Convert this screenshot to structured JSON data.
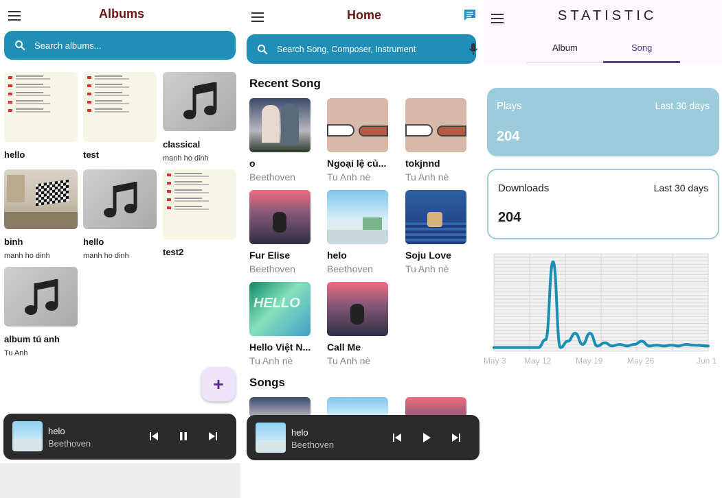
{
  "albums_screen": {
    "title": "Albums",
    "search_placeholder": "Search albums...",
    "albums": [
      {
        "name": "hello",
        "artist": ""
      },
      {
        "name": "test",
        "artist": ""
      },
      {
        "name": "classical",
        "artist": "manh ho dinh"
      },
      {
        "name": "binh",
        "artist": "manh ho dinh"
      },
      {
        "name": "hello",
        "artist": "manh ho dinh"
      },
      {
        "name": "test2",
        "artist": ""
      },
      {
        "name": "album tú anh",
        "artist": "Tu Anh"
      }
    ],
    "fab_label": "+",
    "player": {
      "title": "helo",
      "artist": "Beethoven",
      "state": "playing"
    }
  },
  "home_screen": {
    "title": "Home",
    "search_placeholder": "Search Song, Composer, Instrument",
    "recent_heading": "Recent Song",
    "recent": [
      {
        "title": "o",
        "artist": "Beethoven"
      },
      {
        "title": "Ngoại lệ củ...",
        "artist": "Tu Anh nè"
      },
      {
        "title": "tokjnnd",
        "artist": "Tu Anh nè"
      },
      {
        "title": "Fur Elise",
        "artist": "Beethoven"
      },
      {
        "title": "helo",
        "artist": "Beethoven"
      },
      {
        "title": "Soju Love",
        "artist": "Tu Anh nè"
      },
      {
        "title": "Hello Việt N...",
        "artist": "Tu Anh nè"
      },
      {
        "title": "Call Me",
        "artist": "Tu Anh nè"
      }
    ],
    "songs_heading": "Songs",
    "player": {
      "title": "helo",
      "artist": "Beethoven",
      "state": "paused"
    }
  },
  "statistic_screen": {
    "title": "STATISTIC",
    "tabs": [
      "Album",
      "Song"
    ],
    "active_tab": "Song",
    "plays": {
      "label": "Plays",
      "period": "Last 30 days",
      "value": "204"
    },
    "downloads": {
      "label": "Downloads",
      "period": "Last 30 days",
      "value": "204"
    },
    "colors": {
      "accent": "#1b8fb3",
      "plays_bg": "#9ccbdb",
      "search_bg": "#1f8fb8"
    }
  },
  "chart_data": {
    "type": "line",
    "x": [
      "May 3",
      "May 12",
      "May 19",
      "May 26",
      "Jun 1"
    ],
    "x_ticks": [
      "May 3",
      "May 12",
      "May 19",
      "May 26",
      "Jun 1"
    ],
    "points": [
      [
        0,
        0.2
      ],
      [
        6,
        0.2
      ],
      [
        7,
        1.2
      ],
      [
        8,
        11.0
      ],
      [
        9,
        0.2
      ],
      [
        10,
        1.0
      ],
      [
        11,
        2.0
      ],
      [
        12,
        0.6
      ],
      [
        13,
        2.0
      ],
      [
        14,
        0.4
      ],
      [
        15,
        0.8
      ],
      [
        16,
        0.4
      ],
      [
        17,
        0.6
      ],
      [
        18,
        0.4
      ],
      [
        19,
        0.6
      ],
      [
        20,
        1.0
      ],
      [
        21,
        0.4
      ],
      [
        22,
        0.5
      ],
      [
        23,
        0.4
      ],
      [
        24,
        0.5
      ],
      [
        25,
        0.4
      ],
      [
        26,
        0.6
      ],
      [
        27,
        0.5
      ],
      [
        29,
        0.4
      ]
    ],
    "ylim": [
      0,
      12
    ],
    "grid": true,
    "series": [
      {
        "name": "",
        "color": "#1b8fb3"
      }
    ]
  }
}
